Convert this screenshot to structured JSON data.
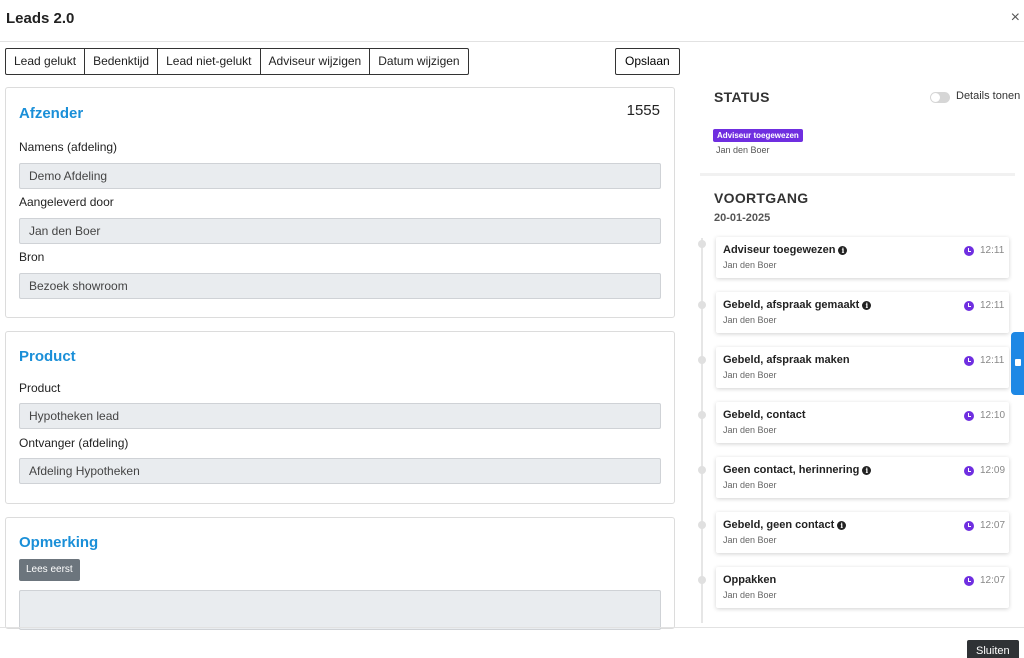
{
  "header": {
    "title": "Leads 2.0",
    "close_icon": "×"
  },
  "toolbar": {
    "buttons": [
      "Lead gelukt",
      "Bedenktijd",
      "Lead niet-gelukt",
      "Adviseur wijzigen",
      "Datum wijzigen"
    ],
    "save_label": "Opslaan"
  },
  "sender": {
    "title": "Afzender",
    "lead_id": "1555",
    "department_label": "Namens (afdeling)",
    "department_value": "Demo Afdeling",
    "delivered_by_label": "Aangeleverd door",
    "delivered_by_value": "Jan den Boer",
    "source_label": "Bron",
    "source_value": "Bezoek showroom"
  },
  "product": {
    "title": "Product",
    "product_label": "Product",
    "product_value": "Hypotheken lead",
    "receiver_label": "Ontvanger (afdeling)",
    "receiver_value": "Afdeling Hypotheken"
  },
  "remark": {
    "title": "Opmerking",
    "read_first_label": "Lees eerst"
  },
  "status": {
    "title": "STATUS",
    "toggle_label": "Details tonen",
    "badge": "Adviseur toegewezen",
    "badge_color": "#6f2ee0",
    "user": "Jan den Boer"
  },
  "progress": {
    "title": "VOORTGANG",
    "date": "20-01-2025",
    "items": [
      {
        "title": "Adviseur toegewezen",
        "info": true,
        "user": "Jan den Boer",
        "time": "12:11"
      },
      {
        "title": "Gebeld, afspraak gemaakt",
        "info": true,
        "user": "Jan den Boer",
        "time": "12:11"
      },
      {
        "title": "Gebeld, afspraak maken",
        "info": false,
        "user": "Jan den Boer",
        "time": "12:11"
      },
      {
        "title": "Gebeld, contact",
        "info": false,
        "user": "Jan den Boer",
        "time": "12:10"
      },
      {
        "title": "Geen contact, herinnering",
        "info": true,
        "user": "Jan den Boer",
        "time": "12:09"
      },
      {
        "title": "Gebeld, geen contact",
        "info": true,
        "user": "Jan den Boer",
        "time": "12:07"
      },
      {
        "title": "Oppakken",
        "info": false,
        "user": "Jan den Boer",
        "time": "12:07"
      }
    ]
  },
  "footer": {
    "close_label": "Sluiten"
  },
  "colors": {
    "accent": "#1a8fd8",
    "status_purple": "#6f2ee0",
    "side_tab": "#1e88e5"
  }
}
